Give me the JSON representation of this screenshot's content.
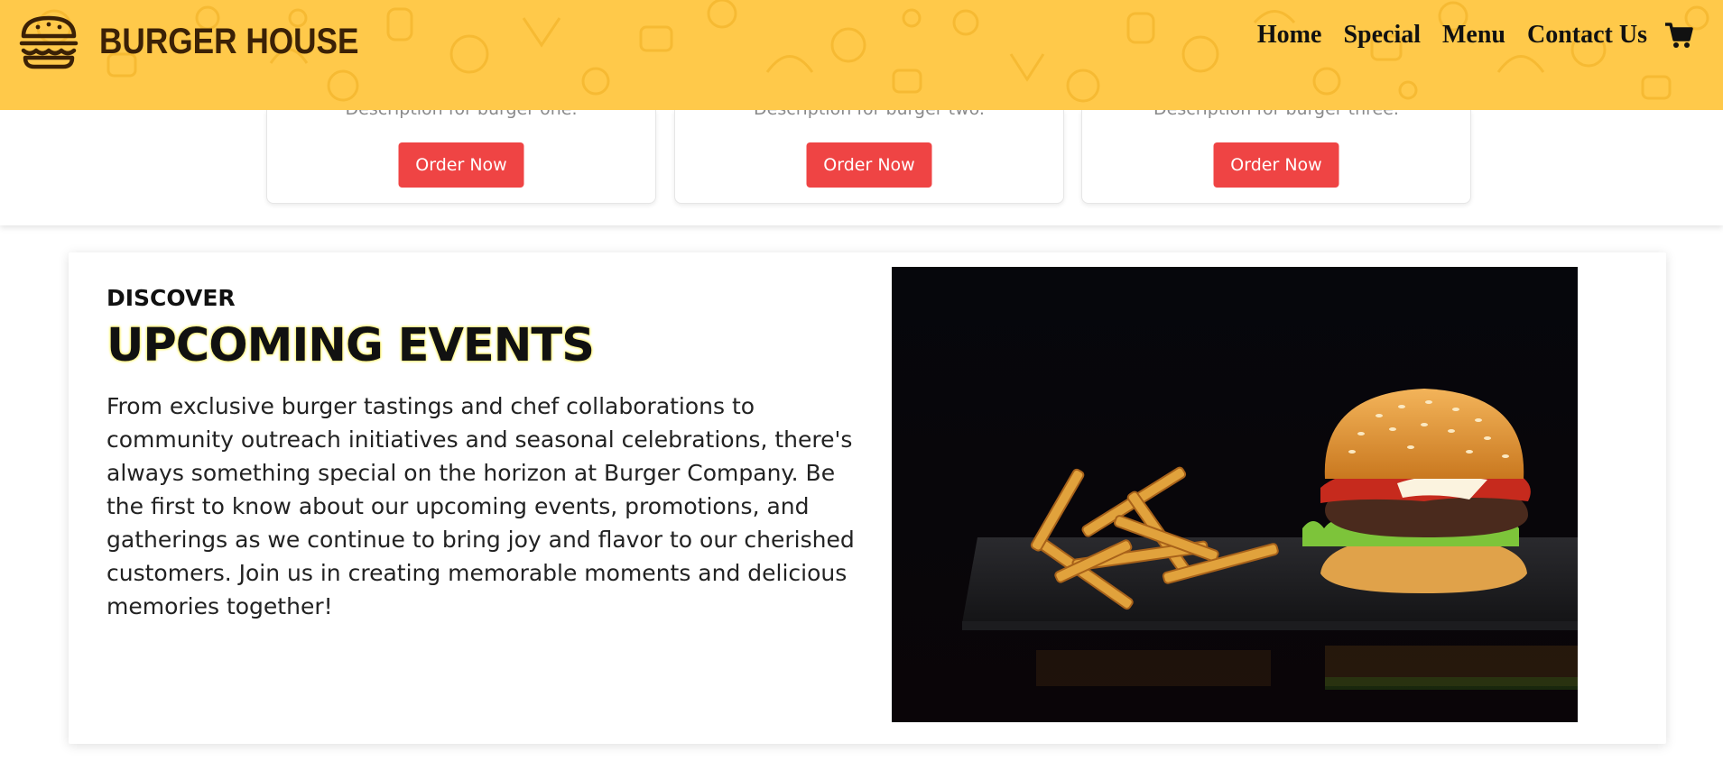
{
  "header": {
    "brand": "BURGER HOUSE",
    "logo_icon": "burger-logo-icon",
    "nav": [
      {
        "label": "Home"
      },
      {
        "label": "Special"
      },
      {
        "label": "Menu"
      },
      {
        "label": "Contact Us"
      }
    ],
    "cart_icon": "shopping-cart-icon",
    "colors": {
      "background": "#ffc94a",
      "brand_text": "#3b2106"
    }
  },
  "products": [
    {
      "description": "Description for burger one.",
      "button": "Order Now"
    },
    {
      "description": "Description for burger two.",
      "button": "Order Now"
    },
    {
      "description": "Description for burger three.",
      "button": "Order Now"
    }
  ],
  "events": {
    "kicker": "DISCOVER",
    "title": "UPCOMING EVENTS",
    "body": "From exclusive burger tastings and chef collaborations to community outreach initiatives and seasonal celebrations, there's always something special on the horizon at Burger Company. Be the first to know about our upcoming events, promotions, and gatherings as we continue to bring joy and flavor to our cherished customers. Join us in creating memorable moments and delicious memories together!",
    "image": "burger-and-fries-photo"
  },
  "colors": {
    "order_button": "#ef4444",
    "title_glow": "#fff36b"
  }
}
